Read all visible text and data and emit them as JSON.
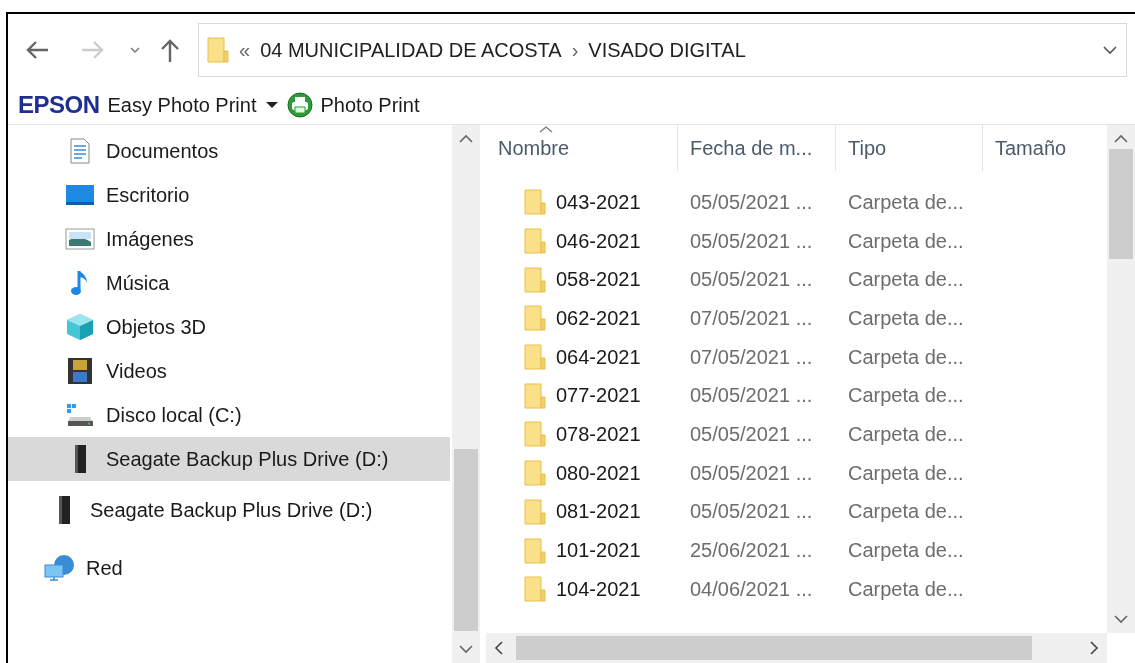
{
  "address_bar": {
    "overflow": "«",
    "crumbs": [
      {
        "label": "04 MUNICIPALIDAD DE ACOSTA",
        "separator": "›"
      },
      {
        "label": "VISADO DIGITAL"
      }
    ]
  },
  "toolbar": {
    "brand": "EPSON",
    "app": "Easy Photo Print",
    "action": "Photo Print"
  },
  "sidebar": {
    "nested_items": [
      {
        "label": "Documentos",
        "kind": "documents",
        "selected": false
      },
      {
        "label": "Escritorio",
        "kind": "desktop",
        "selected": false
      },
      {
        "label": "Imágenes",
        "kind": "pictures",
        "selected": false
      },
      {
        "label": "Música",
        "kind": "music",
        "selected": false
      },
      {
        "label": "Objetos 3D",
        "kind": "objects3d",
        "selected": false
      },
      {
        "label": "Videos",
        "kind": "videos",
        "selected": false
      },
      {
        "label": "Disco local (C:)",
        "kind": "disk",
        "selected": false
      },
      {
        "label": "Seagate Backup Plus Drive (D:)",
        "kind": "drive",
        "selected": true
      }
    ],
    "items": [
      {
        "label": "Seagate Backup Plus Drive (D:)",
        "kind": "drive",
        "selected": false
      },
      {
        "label": "Red",
        "kind": "network",
        "selected": false
      }
    ]
  },
  "table": {
    "columns": [
      "Nombre",
      "Fecha de m...",
      "Tipo",
      "Tamaño"
    ],
    "rows": [
      {
        "name": "043-2021",
        "date": "05/05/2021 ...",
        "type": "Carpeta de..."
      },
      {
        "name": "046-2021",
        "date": "05/05/2021 ...",
        "type": "Carpeta de..."
      },
      {
        "name": "058-2021",
        "date": "05/05/2021 ...",
        "type": "Carpeta de..."
      },
      {
        "name": "062-2021",
        "date": "07/05/2021 ...",
        "type": "Carpeta de..."
      },
      {
        "name": "064-2021",
        "date": "07/05/2021 ...",
        "type": "Carpeta de..."
      },
      {
        "name": "077-2021",
        "date": "05/05/2021 ...",
        "type": "Carpeta de..."
      },
      {
        "name": "078-2021",
        "date": "05/05/2021 ...",
        "type": "Carpeta de..."
      },
      {
        "name": "080-2021",
        "date": "05/05/2021 ...",
        "type": "Carpeta de..."
      },
      {
        "name": "081-2021",
        "date": "05/05/2021 ...",
        "type": "Carpeta de..."
      },
      {
        "name": "101-2021",
        "date": "25/06/2021 ...",
        "type": "Carpeta de..."
      },
      {
        "name": "104-2021",
        "date": "04/06/2021 ...",
        "type": "Carpeta de..."
      }
    ]
  }
}
